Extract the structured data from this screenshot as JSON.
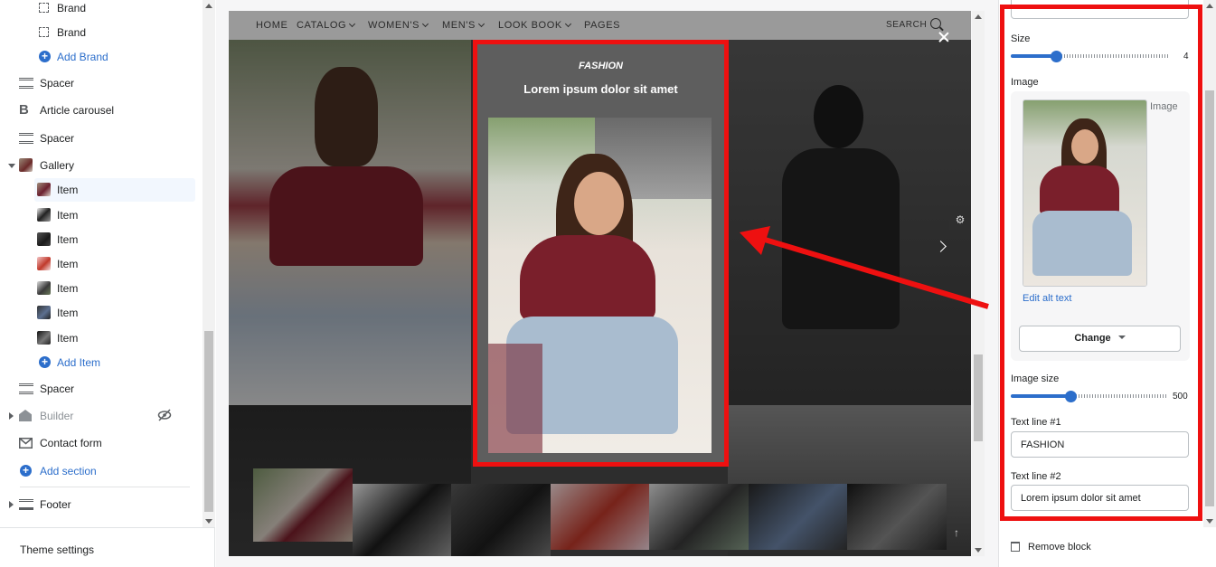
{
  "sidebar": {
    "items": [
      {
        "label": "Brand"
      },
      {
        "label": "Brand"
      },
      {
        "label": "Add Brand"
      },
      {
        "label": "Spacer"
      },
      {
        "label": "Article carousel"
      },
      {
        "label": "Spacer"
      },
      {
        "label": "Gallery"
      },
      {
        "label": "Item"
      },
      {
        "label": "Item"
      },
      {
        "label": "Item"
      },
      {
        "label": "Item"
      },
      {
        "label": "Item"
      },
      {
        "label": "Item"
      },
      {
        "label": "Item"
      },
      {
        "label": "Add Item"
      },
      {
        "label": "Spacer"
      },
      {
        "label": "Builder"
      },
      {
        "label": "Contact form"
      },
      {
        "label": "Add section"
      },
      {
        "label": "Footer"
      }
    ],
    "theme_settings": "Theme settings"
  },
  "preview": {
    "nav": [
      "HOME",
      "CATALOG",
      "WOMEN'S",
      "MEN'S",
      "LOOK BOOK",
      "PAGES"
    ],
    "search_label": "SEARCH",
    "lightbox": {
      "category": "FASHION",
      "title": "Lorem ipsum dolor sit amet"
    }
  },
  "panel": {
    "size_label": "Size",
    "size_value": "4",
    "size_fraction": 0.28,
    "image_label": "Image",
    "image_caption": "Image",
    "edit_alt": "Edit alt text",
    "change_label": "Change",
    "image_size_label": "Image size",
    "image_size_value": "500",
    "image_size_fraction": 0.38,
    "text1_label": "Text line #1",
    "text1_value": "FASHION",
    "text2_label": "Text line #2",
    "text2_value": "Lorem ipsum dolor sit amet",
    "remove_block": "Remove block"
  },
  "colors": {
    "accent": "#2c6ecb",
    "highlight": "#ee1010"
  }
}
